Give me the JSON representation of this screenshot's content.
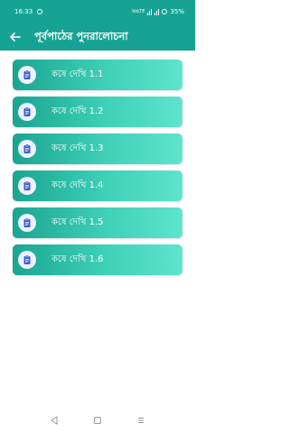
{
  "status_bar": {
    "time": "16:33",
    "network": "VoLTE",
    "battery": "35%"
  },
  "header": {
    "title": "পূর্বপাঠের পুনরালোচনা",
    "back_icon": "arrow-left-icon"
  },
  "items": [
    {
      "label": "কষে দেখি 1.1",
      "icon": "clipboard-icon"
    },
    {
      "label": "কষে দেখি 1.2",
      "icon": "clipboard-icon"
    },
    {
      "label": "কষে দেখি 1.3",
      "icon": "clipboard-icon"
    },
    {
      "label": "কষে দেখি 1.4",
      "icon": "clipboard-icon"
    },
    {
      "label": "কষে দেখি 1.5",
      "icon": "clipboard-icon"
    },
    {
      "label": "কষে দেখি 1.6",
      "icon": "clipboard-icon"
    }
  ],
  "colors": {
    "primary": "#16a394",
    "gradient_start": "#1aa592",
    "gradient_end": "#5ee4cd",
    "icon_bg": "#eef3ff",
    "icon_fg": "#3b5bdb"
  },
  "nav_bar": {
    "back": "triangle-back-icon",
    "home": "square-home-icon",
    "recents": "menu-recents-icon"
  }
}
